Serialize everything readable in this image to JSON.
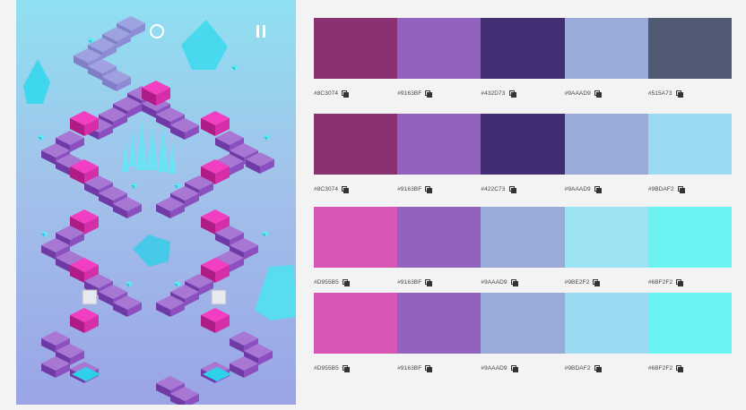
{
  "game": {
    "restart_icon": "restart-ring-icon",
    "pause_icon": "pause-icon"
  },
  "palettes": [
    {
      "swatches": [
        {
          "hex": "#8C3074",
          "label": "#8C3074"
        },
        {
          "hex": "#9163BF",
          "label": "#9163BF"
        },
        {
          "hex": "#432D73",
          "label": "#432D73"
        },
        {
          "hex": "#9AAAD9",
          "label": "#9AAAD9"
        },
        {
          "hex": "#515A73",
          "label": "#515A73"
        }
      ]
    },
    {
      "swatches": [
        {
          "hex": "#8C3074",
          "label": "#8C3074"
        },
        {
          "hex": "#9163BF",
          "label": "#9163BF"
        },
        {
          "hex": "#422C73",
          "label": "#422C73"
        },
        {
          "hex": "#9AAAD9",
          "label": "#9AAAD9"
        },
        {
          "hex": "#9BDAF2",
          "label": "#9BDAF2"
        }
      ]
    },
    {
      "swatches": [
        {
          "hex": "#D955B5",
          "label": "#D955B5"
        },
        {
          "hex": "#9163BF",
          "label": "#9163BF"
        },
        {
          "hex": "#9AAAD9",
          "label": "#9AAAD9"
        },
        {
          "hex": "#9BE2F2",
          "label": "#9BE2F2"
        },
        {
          "hex": "#6BF2F2",
          "label": "#6BF2F2"
        }
      ]
    },
    {
      "swatches": [
        {
          "hex": "#D955B5",
          "label": "#D955B5"
        },
        {
          "hex": "#9163BF",
          "label": "#9163BF"
        },
        {
          "hex": "#9AAAD9",
          "label": "#9AAAD9"
        },
        {
          "hex": "#9BDAF2",
          "label": "#9BDAF2"
        },
        {
          "hex": "#6BF2F2",
          "label": "#6BF2F2"
        }
      ]
    }
  ]
}
